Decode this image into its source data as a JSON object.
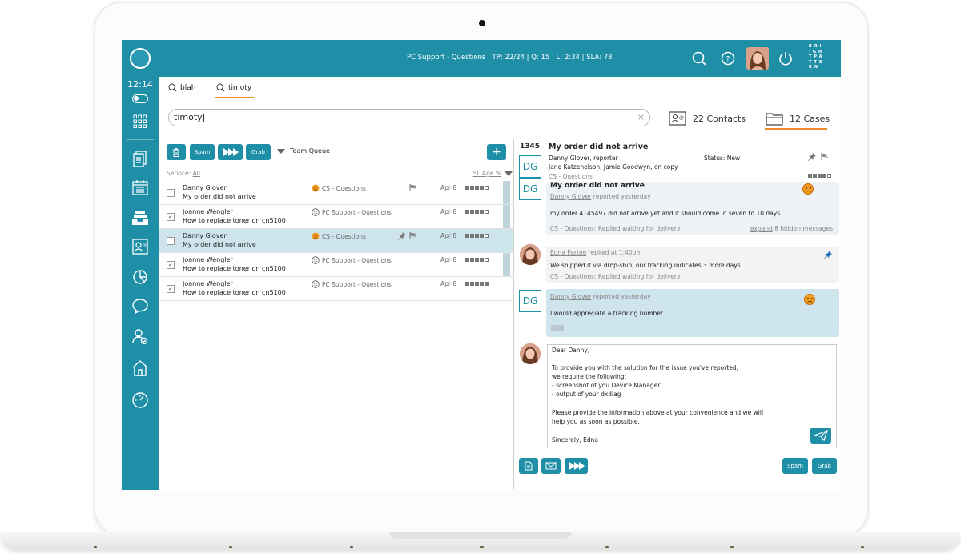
{
  "topbar": {
    "status": "PC Support - Questions | TP: 22/24 | Q: 15 | L: 2:34 | SLA: 78",
    "brand_letters": [
      "B",
      "R",
      "I",
      "·",
      "G",
      "H",
      "T",
      "P",
      "A",
      "T",
      "T",
      "E",
      "R",
      "N"
    ]
  },
  "sidebar": {
    "clock": "12:14",
    "items": [
      "status-toggle",
      "dial-pad",
      "notes",
      "calendar",
      "inbox",
      "contacts",
      "reports",
      "chat",
      "agent-status",
      "home",
      "dashboard"
    ]
  },
  "search": {
    "tabs": [
      {
        "label": "blah",
        "active": false
      },
      {
        "label": "timoty",
        "active": true
      }
    ],
    "value": "timoty|",
    "clear": "×"
  },
  "results": {
    "contacts_label": "22 Contacts",
    "cases_label": "12 Cases"
  },
  "toolbar": {
    "spam": "Spam",
    "grab": "Grab",
    "queue": "Team Queue",
    "add": "+"
  },
  "filters": {
    "service_label": "Service:",
    "service_value": "All",
    "sort_label": "SL Age %"
  },
  "cases": [
    {
      "name": "Danny Glover",
      "subject": "My order did not arrive",
      "service": "CS - Questions",
      "date": "Apr 8",
      "checked": false,
      "mood": "sad",
      "selected": false,
      "flags": "flag"
    },
    {
      "name": "Joanne Wengler",
      "subject": "How to replace toner on cn5100",
      "service": "PC Support - Questions",
      "date": "Apr 8",
      "checked": true,
      "mood": "neutral",
      "selected": false,
      "flags": ""
    },
    {
      "name": "Danny Glover",
      "subject": "My order did not arrive",
      "service": "CS - Questions",
      "date": "Apr 8",
      "checked": false,
      "mood": "sad",
      "selected": true,
      "flags": "pin-flag"
    },
    {
      "name": "Joanne Wengler",
      "subject": "How to replace toner on cn5100",
      "service": "PC Support - Questions",
      "date": "Apr 8",
      "checked": true,
      "mood": "neutral",
      "selected": false,
      "flags": ""
    },
    {
      "name": "Joanne Wengler",
      "subject": "How to replace toner on cn5100",
      "service": "PC Support - Questions",
      "date": "Apr 8",
      "checked": true,
      "mood": "neutral",
      "selected": false,
      "flags": ""
    }
  ],
  "case_detail": {
    "number": "1345",
    "title": "My order did not arrive",
    "people_line1": "Danny Glover, reporter",
    "people_line2": "Jane Katzenelson, Jamie Goodwyn, on copy",
    "queue": "CS - Questions",
    "status": "Status: New",
    "initials": "DG"
  },
  "messages": {
    "first": {
      "title": "My order did not arrive",
      "author": "Danny Glover",
      "when": "reported yesterday",
      "body": "my order 4145497 did not arrive yet and it should come in seven to 10 days",
      "footer": "CS - Questions: Replied waiting for delivery",
      "expand": "expand",
      "expand_rest": " 8 hidden messages"
    },
    "second": {
      "author": "Edna Partee",
      "when": "replied at 1:40pm",
      "body": "We shipped it via drop-ship, our tracking indicates 3 more days",
      "footer": "CS - Questions: Replied waiting for delivery"
    },
    "third": {
      "author": "Danny Glover",
      "when": "reported yesterday",
      "body": "I would appreciate a tracking number",
      "more": "···"
    }
  },
  "reply": {
    "lines": [
      "Dear Danny,",
      "",
      "To provide you with the solution for the issue you've reported,",
      "we require the following:",
      "- screenshot of you Device Manager",
      "- output of your dxdiag",
      "",
      "Please provide the information above at your convenience and we will",
      "help you as soon as possible.",
      "",
      "Sincerely, Edna"
    ]
  },
  "bottom_toolbar": {
    "spam": "Spam",
    "grab": "Grab"
  },
  "colors": {
    "accent": "#1e8fa7",
    "highlight": "#f28c28",
    "selected_row": "#cfe5ee"
  }
}
